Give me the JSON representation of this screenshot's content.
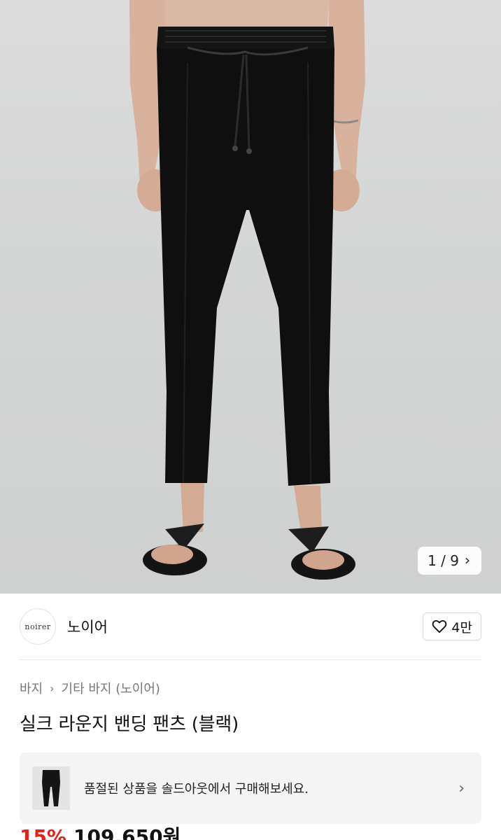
{
  "gallery": {
    "counter": "1 / 9",
    "next_icon": "chevron-right-icon"
  },
  "brand": {
    "logo_text": "noirer",
    "name": "노이어",
    "like_count": "4만",
    "like_icon": "heart-icon"
  },
  "breadcrumb": {
    "items": [
      "바지",
      "기타 바지 (노이어)"
    ]
  },
  "product": {
    "title": "실크 라운지 밴딩 팬츠 (블랙)"
  },
  "soldout_banner": {
    "text": "품절된 상품을 솔드아웃에서 구매해보세요."
  },
  "price": {
    "discount": "15%",
    "amount": "109,650원",
    "discount_color": "#e5201c"
  }
}
